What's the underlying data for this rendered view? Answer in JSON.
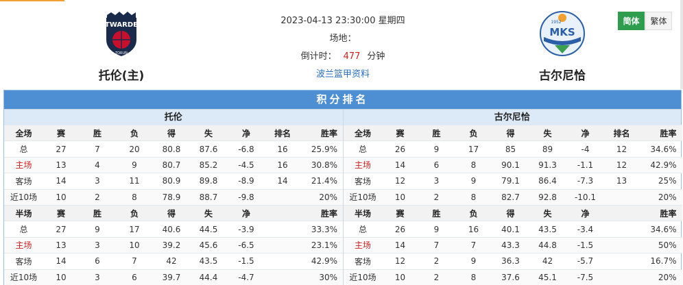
{
  "match": {
    "datetime": "2023-04-13 23:30:00 星期四",
    "venue_label": "场地：",
    "countdown_label": "倒计时：",
    "countdown_value": "477",
    "countdown_unit": "分钟",
    "league_link": "波兰篮甲资料"
  },
  "home": {
    "name": "托伦(主)",
    "logo_text": "TWARDE",
    "logo_sub": "TORUŃ"
  },
  "away": {
    "name": "古尔尼恰",
    "logo_text": "MKS",
    "logo_year": "1952"
  },
  "lang": {
    "simplified": "简体",
    "traditional": "繁体"
  },
  "colors": {
    "accent_green": "#2e9e4e",
    "title_blue": "#4e8ed3",
    "highlight_red": "#d02020"
  },
  "standings": {
    "title": "积分排名",
    "panels": [
      {
        "team": "托伦",
        "full_header": [
          "全场",
          "赛",
          "胜",
          "负",
          "得",
          "失",
          "净",
          "排名",
          "胜率"
        ],
        "full_rows": [
          [
            "总",
            "27",
            "7",
            "20",
            "80.8",
            "87.6",
            "-6.8",
            "16",
            "25.9%"
          ],
          [
            "主场",
            "13",
            "4",
            "9",
            "80.7",
            "85.2",
            "-4.5",
            "16",
            "30.8%"
          ],
          [
            "客场",
            "14",
            "3",
            "11",
            "80.9",
            "89.8",
            "-8.9",
            "14",
            "21.4%"
          ],
          [
            "近10场",
            "10",
            "2",
            "8",
            "78.9",
            "88.7",
            "-9.8",
            "",
            "20%"
          ]
        ],
        "half_header": [
          "半场",
          "赛",
          "胜",
          "负",
          "得",
          "失",
          "净",
          "",
          "胜率"
        ],
        "half_rows": [
          [
            "总",
            "27",
            "9",
            "17",
            "40.6",
            "44.5",
            "-3.9",
            "",
            "33.3%"
          ],
          [
            "主场",
            "13",
            "3",
            "10",
            "39.2",
            "45.6",
            "-6.5",
            "",
            "23.1%"
          ],
          [
            "客场",
            "14",
            "6",
            "7",
            "42",
            "43.5",
            "-1.5",
            "",
            "42.9%"
          ],
          [
            "近10场",
            "10",
            "3",
            "6",
            "39.7",
            "44.4",
            "-4.7",
            "",
            "30%"
          ]
        ]
      },
      {
        "team": "古尔尼恰",
        "full_header": [
          "全场",
          "赛",
          "胜",
          "负",
          "得",
          "失",
          "净",
          "排名",
          "胜率"
        ],
        "full_rows": [
          [
            "总",
            "26",
            "9",
            "17",
            "85",
            "89",
            "-4",
            "12",
            "34.6%"
          ],
          [
            "主场",
            "14",
            "6",
            "8",
            "90.1",
            "91.3",
            "-1.1",
            "12",
            "42.9%"
          ],
          [
            "客场",
            "12",
            "3",
            "9",
            "79.1",
            "86.4",
            "-7.3",
            "13",
            "25%"
          ],
          [
            "近10场",
            "10",
            "2",
            "8",
            "82.7",
            "92.8",
            "-10.1",
            "",
            "20%"
          ]
        ],
        "half_header": [
          "半场",
          "赛",
          "胜",
          "负",
          "得",
          "失",
          "净",
          "",
          "胜率"
        ],
        "half_rows": [
          [
            "总",
            "26",
            "9",
            "16",
            "40.1",
            "43.5",
            "-3.4",
            "",
            "34.6%"
          ],
          [
            "主场",
            "14",
            "7",
            "7",
            "43.3",
            "44.8",
            "-1.5",
            "",
            "50%"
          ],
          [
            "客场",
            "12",
            "2",
            "9",
            "36.3",
            "42",
            "-5.7",
            "",
            "16.7%"
          ],
          [
            "近10场",
            "10",
            "2",
            "8",
            "37.6",
            "45.1",
            "-7.5",
            "",
            "20%"
          ]
        ]
      }
    ]
  }
}
